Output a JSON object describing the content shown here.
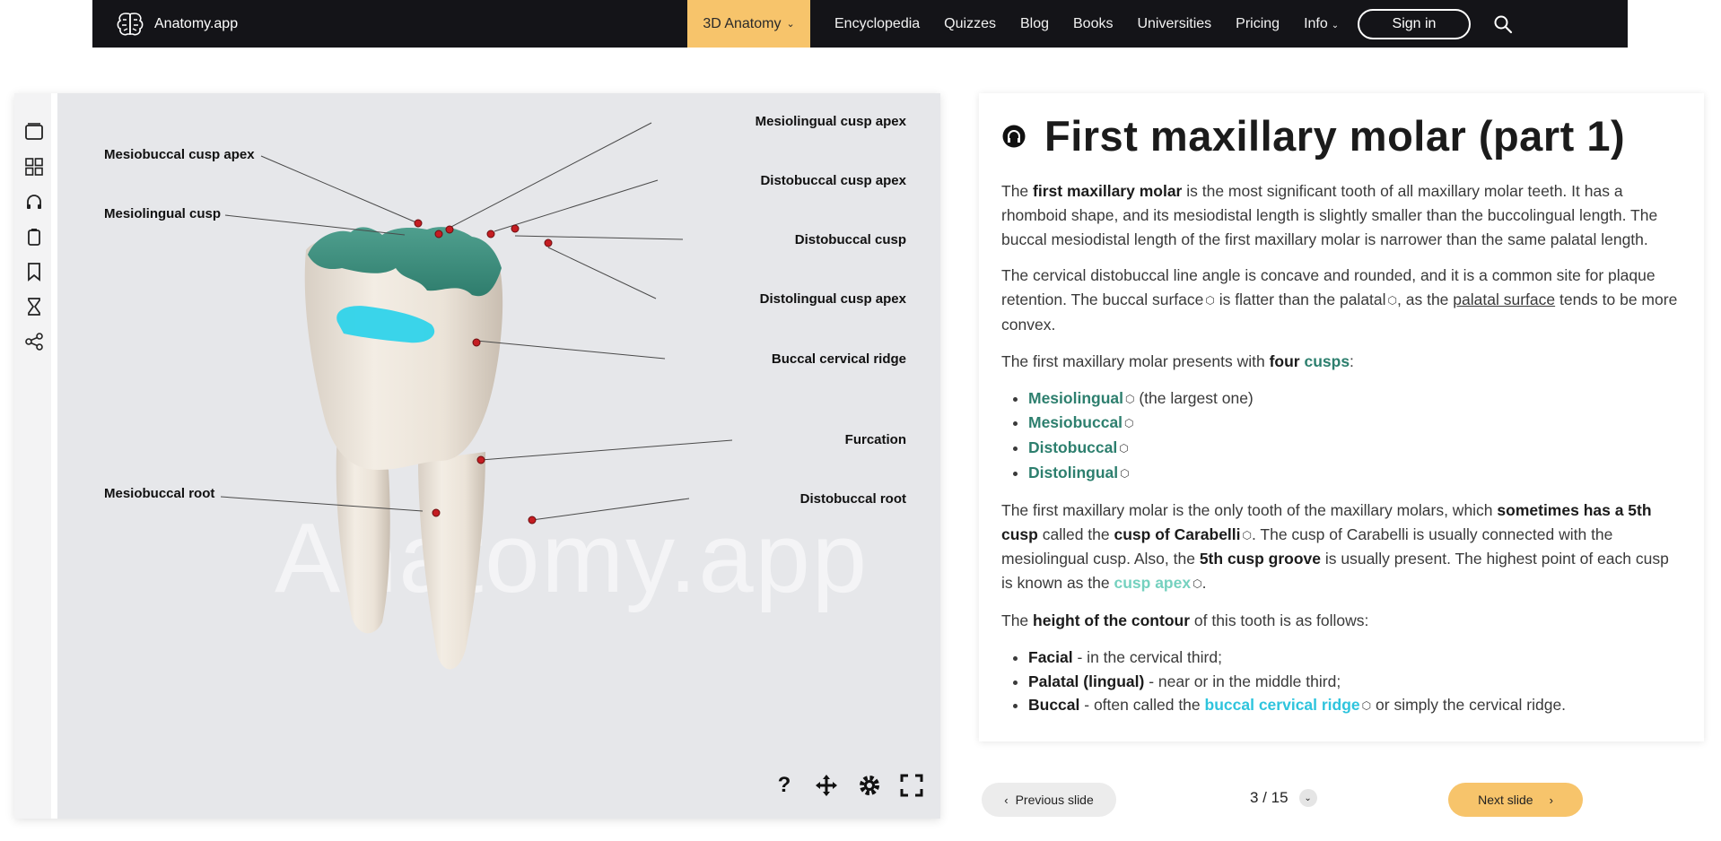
{
  "header": {
    "brand": "Anatomy.app",
    "active_nav": "3D Anatomy",
    "nav": [
      "Encyclopedia",
      "Quizzes",
      "Blog",
      "Books",
      "Universities",
      "Pricing",
      "Info"
    ],
    "signin": "Sign in"
  },
  "viewer": {
    "watermark": "Anatomy.app",
    "labels": {
      "mesiobuccal_cusp_apex": "Mesiobuccal cusp apex",
      "mesiolingual_cusp": "Mesiolingual cusp",
      "mesiobuccal_root": "Mesiobuccal root",
      "mesiolingual_cusp_apex": "Mesiolingual cusp apex",
      "distobuccal_cusp_apex": "Distobuccal cusp apex",
      "distobuccal_cusp": "Distobuccal cusp",
      "distolingual_cusp_apex": "Distolingual cusp apex",
      "buccal_cervical_ridge": "Buccal cervical ridge",
      "furcation": "Furcation",
      "distobuccal_root": "Distobuccal root"
    },
    "toolbar_icons": [
      "slides-icon",
      "grid-icon",
      "headphones-icon",
      "clipboard-icon",
      "bookmark-icon",
      "hourglass-icon",
      "share-icon"
    ],
    "controls": [
      "help-icon",
      "move-icon",
      "settings-icon",
      "fullscreen-icon"
    ]
  },
  "article": {
    "title": "First maxillary molar (part 1)",
    "p1": {
      "a": "The ",
      "b": "first maxillary molar",
      "c": " is the most significant tooth of all maxillary molar teeth. It has a rhomboid shape, and its mesiodistal length is slightly smaller than the buccolingual length. The buccal mesiodistal length of the first maxillary molar is narrower than the same palatal length."
    },
    "p2": {
      "a": "The cervical distobuccal line angle is concave and rounded, and it is a common site for plaque retention. The buccal surface",
      "b": " is flatter than the palatal",
      "c": ", as the ",
      "d": "palatal surface",
      "e": " tends to be more convex."
    },
    "p3": {
      "a": "The first maxillary molar presents with ",
      "b": "four",
      "c": "cusps",
      "d": ":"
    },
    "cusps": [
      {
        "name": "Mesiolingual",
        "note": " (the largest one)"
      },
      {
        "name": "Mesiobuccal",
        "note": ""
      },
      {
        "name": "Distobuccal",
        "note": ""
      },
      {
        "name": "Distolingual",
        "note": ""
      }
    ],
    "p4": {
      "a": "The first maxillary molar is the only tooth of the maxillary molars, which ",
      "b": "sometimes has a 5th cusp",
      "c": " called the ",
      "d": "cusp of Carabelli",
      "e": ". The cusp of Carabelli is usually connected with the mesiolingual cusp. Also, the ",
      "f": "5th cusp groove",
      "g": " is usually present. The highest point of each cusp is known as the ",
      "h": "cusp apex",
      "i": "."
    },
    "p5": {
      "a": "The ",
      "b": "height of the contour",
      "c": " of this tooth is as follows:"
    },
    "contour": [
      {
        "term": "Facial",
        "desc": " - in the cervical third;"
      },
      {
        "term": "Palatal (lingual)",
        "desc": " - near or in the middle third;"
      },
      {
        "term": "Buccal",
        "desc": " - often called the ",
        "link": "buccal cervical ridge",
        "tail": " or simply the cervical ridge."
      }
    ]
  },
  "pager": {
    "prev": "Previous slide",
    "next": "Next slide",
    "current": "3 / 15"
  }
}
